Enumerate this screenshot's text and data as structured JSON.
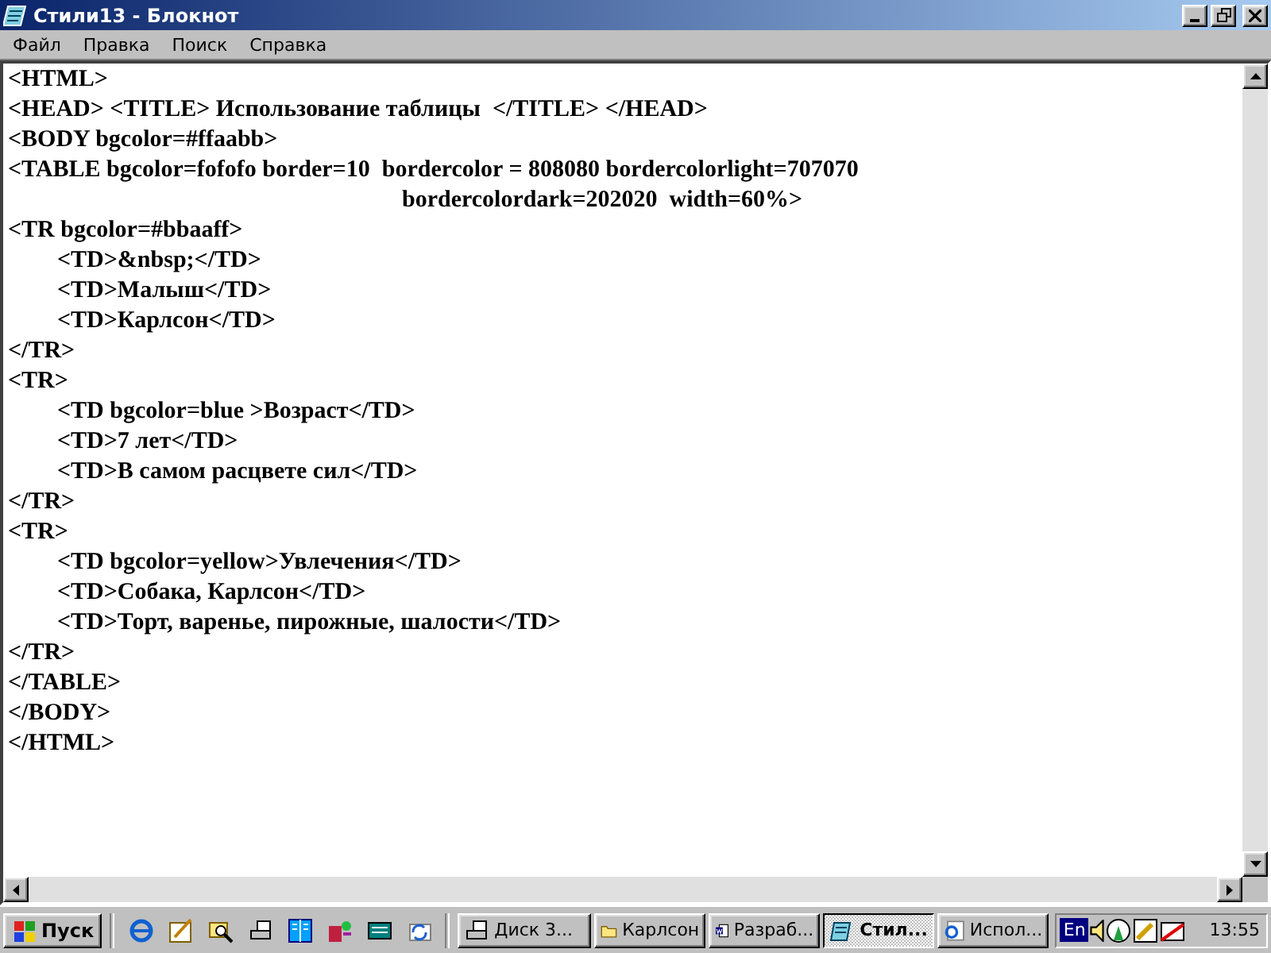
{
  "window": {
    "title": "Стили13 - Блокнот"
  },
  "menu": [
    "Файл",
    "Правка",
    "Поиск",
    "Справка"
  ],
  "editor": {
    "lines": [
      "<HTML>",
      "<HEAD> <TITLE> Использование таблицы  </TITLE> </HEAD>",
      "<BODY bgcolor=#ffaabb>",
      "<TABLE bgcolor=fofofo border=10  bordercolor = 808080 bordercolorlight=707070",
      "\t\t\t\t\t\t\t\tbordercolordark=202020  width=60%>",
      "<TR bgcolor=#bbaaff>",
      "\t<TD>&nbsp;</TD>",
      "\t<TD>Малыш</TD>",
      "\t<TD>Карлсон</TD>",
      "</TR>",
      "<TR>",
      "\t<TD bgcolor=blue >Возраст</TD>",
      "\t<TD>7 лет</TD>",
      "\t<TD>В самом расцвете сил</TD>",
      "</TR>",
      "<TR>",
      "\t<TD bgcolor=yellow>Увлечения</TD>",
      "\t<TD>Собака, Карлсон</TD>",
      "\t<TD>Торт, варенье, пирожные, шалости</TD>",
      "</TR>",
      "</TABLE>",
      "</BODY>",
      "</HTML>"
    ]
  },
  "taskbar": {
    "start": "Пуск",
    "tasks": [
      {
        "label": "Диск 3...",
        "kind": "drive",
        "selected": false
      },
      {
        "label": "Карлсон",
        "kind": "folder",
        "selected": false
      },
      {
        "label": "Разраб...",
        "kind": "word",
        "selected": false
      },
      {
        "label": "Стил...",
        "kind": "notepad",
        "selected": true
      },
      {
        "label": "Испол...",
        "kind": "browser",
        "selected": false
      }
    ],
    "language": "En",
    "clock": "13:55"
  }
}
